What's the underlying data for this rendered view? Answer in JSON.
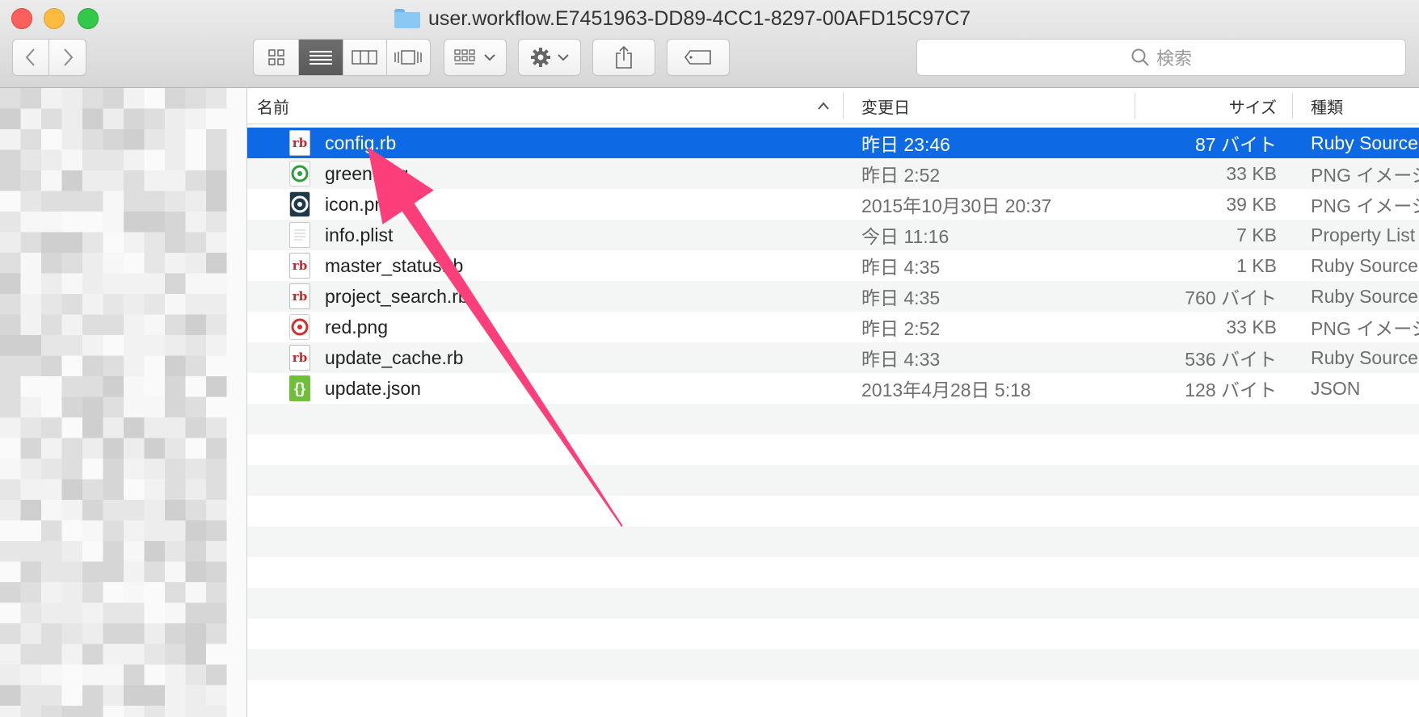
{
  "window": {
    "title": "user.workflow.E7451963-DD89-4CC1-8297-00AFD15C97C7"
  },
  "toolbar": {
    "back_icon": "chevron-left-icon",
    "forward_icon": "chevron-right-icon",
    "view_modes": [
      "icon-view",
      "list-view",
      "column-view",
      "coverflow-view"
    ],
    "active_view": "list-view",
    "search_placeholder": "検索"
  },
  "columns": {
    "name": "名前",
    "date": "変更日",
    "size": "サイズ",
    "kind": "種類"
  },
  "files": [
    {
      "name": "config.rb",
      "date": "昨日 23:46",
      "size": "87 バイト",
      "kind": "Ruby Source",
      "icon": "ruby-file-icon",
      "selected": true
    },
    {
      "name": "green.png",
      "date": "昨日 2:52",
      "size": "33 KB",
      "kind": "PNG イメージ",
      "icon": "png-green-icon",
      "selected": false
    },
    {
      "name": "icon.png",
      "date": "2015年10月30日 20:37",
      "size": "39 KB",
      "kind": "PNG イメージ",
      "icon": "png-dark-icon",
      "selected": false
    },
    {
      "name": "info.plist",
      "date": "今日 11:16",
      "size": "7 KB",
      "kind": "Property List",
      "icon": "plist-file-icon",
      "selected": false
    },
    {
      "name": "master_status.rb",
      "date": "昨日 4:35",
      "size": "1 KB",
      "kind": "Ruby Source",
      "icon": "ruby-file-icon",
      "selected": false
    },
    {
      "name": "project_search.rb",
      "date": "昨日 4:35",
      "size": "760 バイト",
      "kind": "Ruby Source",
      "icon": "ruby-file-icon",
      "selected": false
    },
    {
      "name": "red.png",
      "date": "昨日 2:52",
      "size": "33 KB",
      "kind": "PNG イメージ",
      "icon": "png-red-icon",
      "selected": false
    },
    {
      "name": "update_cache.rb",
      "date": "昨日 4:33",
      "size": "536 バイト",
      "kind": "Ruby Source",
      "icon": "ruby-file-icon",
      "selected": false
    },
    {
      "name": "update.json",
      "date": "2013年4月28日 5:18",
      "size": "128 バイト",
      "kind": "JSON",
      "icon": "json-file-icon",
      "selected": false
    }
  ],
  "colors": {
    "selection": "#0d6ae4",
    "annotation_arrow": "#fc3f7a"
  }
}
